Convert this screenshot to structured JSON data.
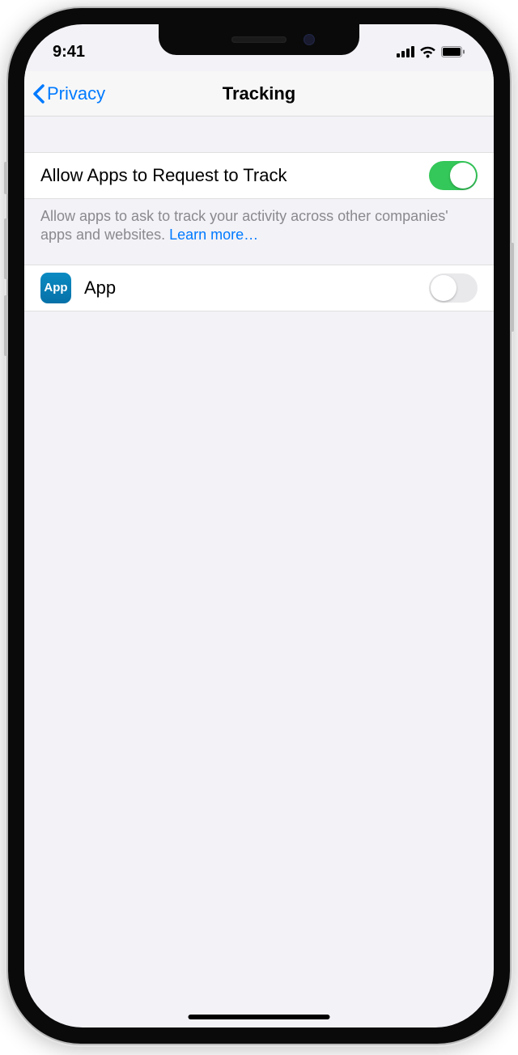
{
  "status": {
    "time": "9:41"
  },
  "nav": {
    "back_label": "Privacy",
    "title": "Tracking"
  },
  "sections": {
    "allow_label": "Allow Apps to Request to Track",
    "allow_on": true,
    "footer_text": "Allow apps to ask to track your activity across other companies' apps and websites. ",
    "footer_link": "Learn more…",
    "apps": [
      {
        "name": "App",
        "icon_text": "App",
        "on": false
      }
    ]
  }
}
